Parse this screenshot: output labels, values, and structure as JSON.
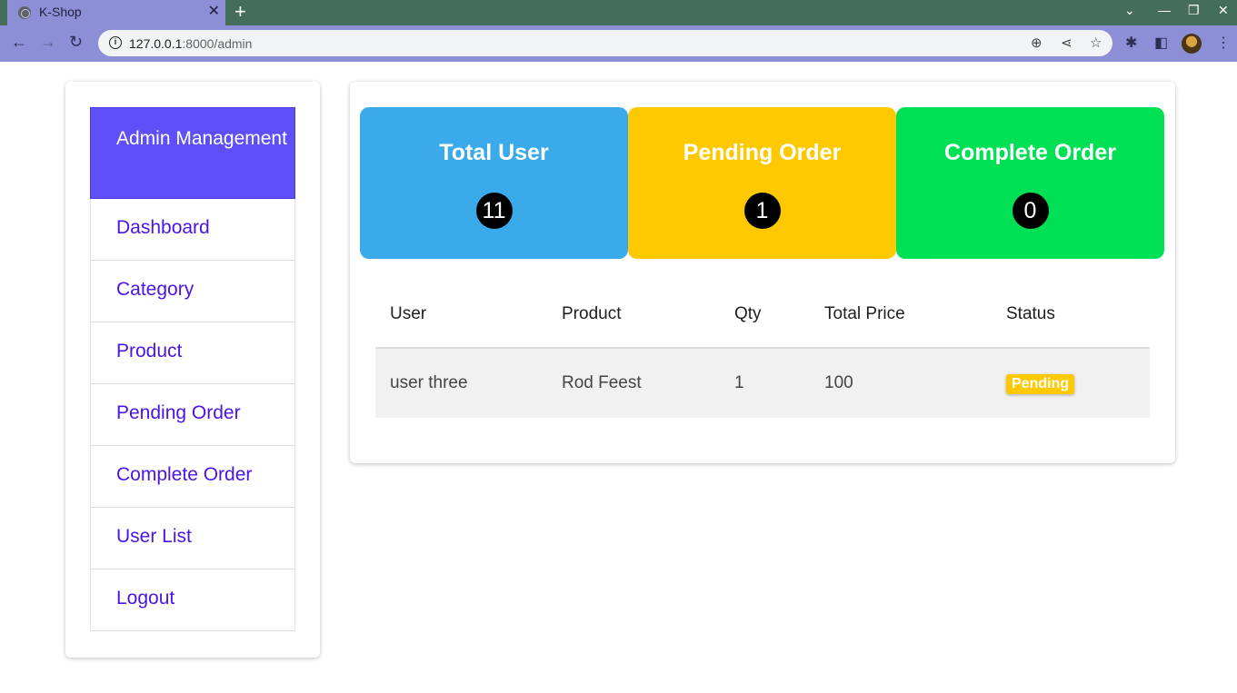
{
  "browser": {
    "tab_title": "K-Shop",
    "url_host": "127.0.0.1",
    "url_rest": ":8000/admin"
  },
  "sidebar": {
    "header": "Admin Management",
    "items": [
      {
        "label": "Dashboard"
      },
      {
        "label": "Category"
      },
      {
        "label": "Product"
      },
      {
        "label": "Pending Order"
      },
      {
        "label": "Complete Order"
      },
      {
        "label": "User List"
      },
      {
        "label": "Logout"
      }
    ]
  },
  "stats": [
    {
      "title": "Total User",
      "count": "11",
      "color": "#3baaea"
    },
    {
      "title": "Pending Order",
      "count": "1",
      "color": "#fec900"
    },
    {
      "title": "Complete Order",
      "count": "0",
      "color": "#00e055"
    }
  ],
  "orders": {
    "columns": [
      "User",
      "Product",
      "Qty",
      "Total Price",
      "Status"
    ],
    "rows": [
      {
        "user": "user three",
        "product": "Rod Feest",
        "qty": "1",
        "total_price": "100",
        "status": "Pending"
      }
    ]
  },
  "colors": {
    "accent": "#5e4ff8",
    "link": "#4b15e5",
    "pending": "#fec900"
  }
}
